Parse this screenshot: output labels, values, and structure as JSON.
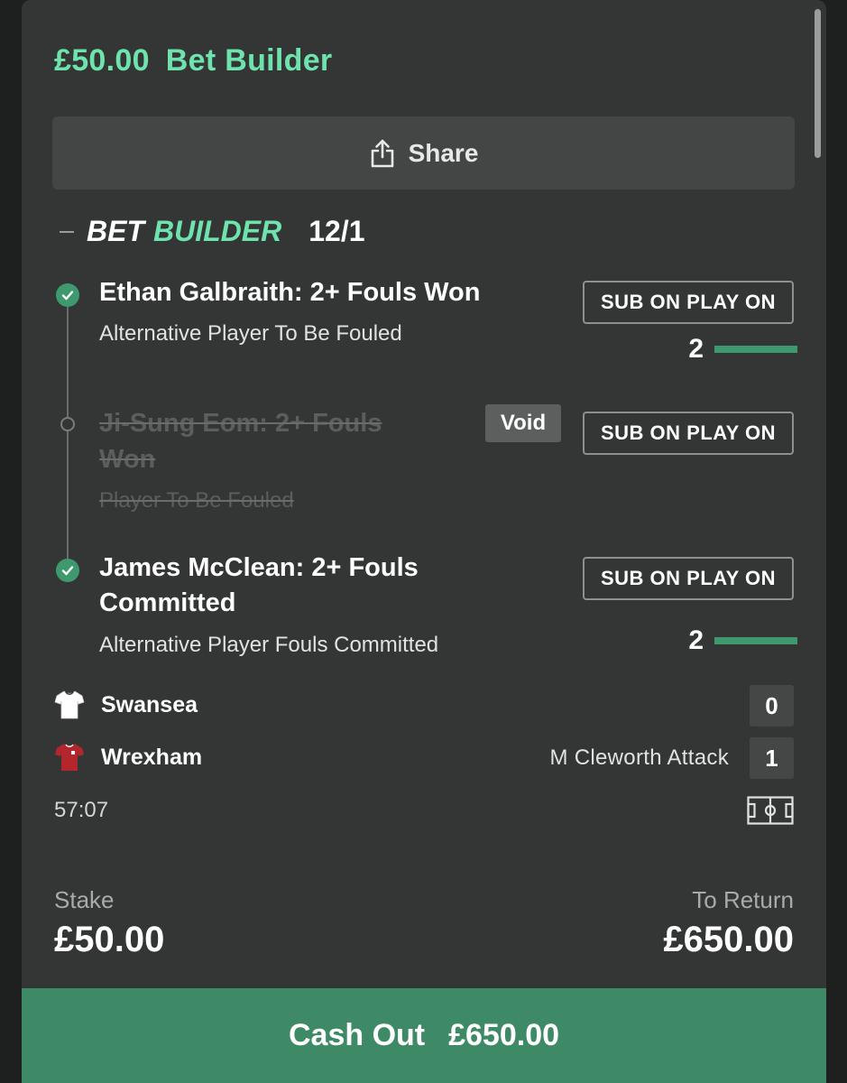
{
  "header": {
    "stake": "£50.00",
    "bet_type": "Bet Builder"
  },
  "share": {
    "label": "Share",
    "icon": "share-icon"
  },
  "bet_builder": {
    "label_part1": "BET",
    "label_part2": "BUILDER",
    "odds": "12/1",
    "selections": [
      {
        "title": "Ethan Galbraith: 2+ Fouls Won",
        "market": "Alternative Player To Be Fouled",
        "badge": "SUB ON PLAY ON",
        "status": "won",
        "progress": {
          "value": "2",
          "fraction": 1.0
        }
      },
      {
        "title_line1": "Ji-Sung Eom: 2+ Fouls",
        "title_line2": "Won",
        "market": "Player To Be Fouled",
        "badge": "SUB ON PLAY ON",
        "status": "void",
        "void_label": "Void"
      },
      {
        "title_line1": "James McClean: 2+ Fouls",
        "title_line2": "Committed",
        "market": "Alternative Player Fouls Committed",
        "badge": "SUB ON PLAY ON",
        "status": "won",
        "progress": {
          "value": "2",
          "fraction": 1.0
        }
      }
    ]
  },
  "match": {
    "home": {
      "name": "Swansea",
      "score": "0",
      "kit_color": "#ffffff"
    },
    "away": {
      "name": "Wrexham",
      "score": "1",
      "kit_color": "#b3262e"
    },
    "event": "M Cleworth Attack",
    "clock": "57:07"
  },
  "summary": {
    "stake_label": "Stake",
    "stake_value": "£50.00",
    "return_label": "To Return",
    "return_value": "£650.00"
  },
  "cashout": {
    "label": "Cash Out",
    "amount": "£650.00"
  },
  "colors": {
    "accent": "#6fe3ad",
    "success": "#3e9a6e",
    "cashout_bg": "#3f8a66",
    "card_bg": "#333635"
  }
}
